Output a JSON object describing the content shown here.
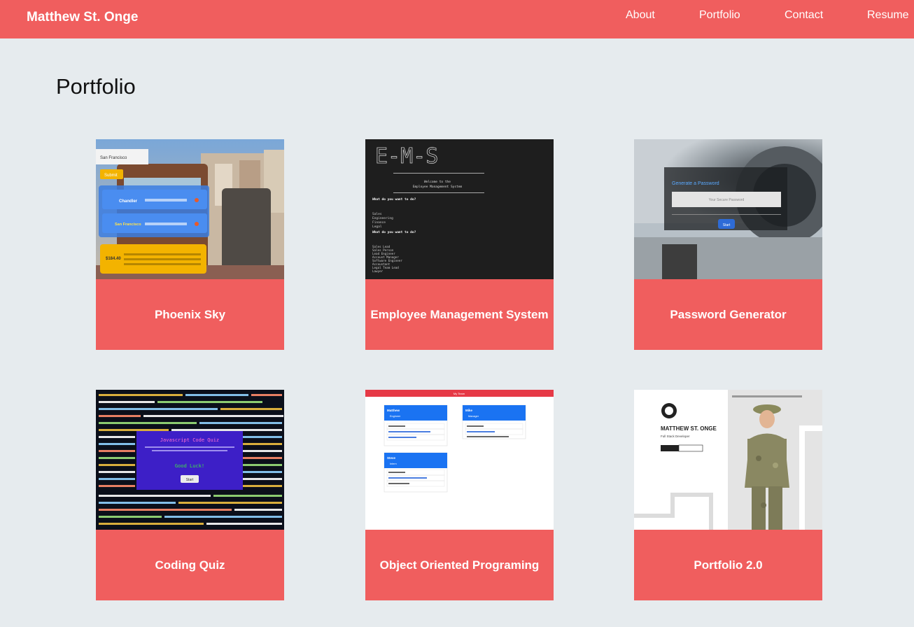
{
  "nav": {
    "brand": "Matthew St. Onge",
    "links": [
      "About",
      "Portfolio",
      "Contact",
      "Resume"
    ]
  },
  "page": {
    "title": "Portfolio"
  },
  "projects": [
    {
      "title": "Phoenix Sky",
      "preview": {
        "search_city": "San Francisco",
        "submit": "Submit",
        "rows": [
          "Chandler",
          "San Francisco"
        ],
        "price": "$184.40"
      }
    },
    {
      "title": "Employee Management System",
      "preview": {
        "banner": "E-M-S",
        "welcome": "Welcome to the",
        "subtitle": "Employee Management System",
        "prompt": "What do you want to do?",
        "departments": [
          "Sales",
          "Engineering",
          "Finance",
          "Legal"
        ],
        "roles": [
          "Sales Lead",
          "Sales Person",
          "Lead Engineer",
          "Account Manager",
          "Software Engineer",
          "Accountant",
          "Legal Team Lead",
          "Lawyer"
        ]
      }
    },
    {
      "title": "Password Generator",
      "preview": {
        "heading": "Generate a Password",
        "placeholder": "Your Secure Password",
        "button": "Start"
      }
    },
    {
      "title": "Coding Quiz",
      "preview": {
        "heading": "Javascript Code Quiz",
        "luck": "Good Luck!",
        "button": "Start"
      }
    },
    {
      "title": "Object Oriented Programing",
      "preview": {
        "header": "My Team",
        "members": [
          {
            "name": "Matthew",
            "role": "Engineer"
          },
          {
            "name": "Mike",
            "role": "Manager"
          },
          {
            "name": "Steve",
            "role": "Intern"
          }
        ]
      }
    },
    {
      "title": "Portfolio 2.0",
      "preview": {
        "name": "MATTHEW ST. ONGE",
        "subtitle": "Full Stack Developer"
      }
    }
  ],
  "colors": {
    "accent": "#f05e5e",
    "background": "#e6ebee"
  }
}
